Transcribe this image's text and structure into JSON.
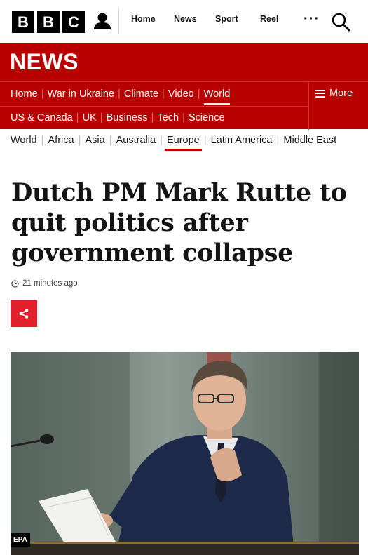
{
  "header": {
    "logo_letters": [
      "B",
      "B",
      "C"
    ],
    "nav": [
      "Home",
      "News",
      "Sport",
      "Reel"
    ],
    "more_label": "···",
    "icons": {
      "account": "account-icon",
      "search": "search-icon"
    }
  },
  "banner": {
    "title": "NEWS",
    "color": "#b80000"
  },
  "primary_nav": {
    "row1": [
      "Home",
      "War in Ukraine",
      "Climate",
      "Video",
      "World"
    ],
    "row2": [
      "US & Canada",
      "UK",
      "Business",
      "Tech",
      "Science"
    ],
    "active": "World",
    "more_label": "More"
  },
  "secondary_nav": {
    "items": [
      "World",
      "Africa",
      "Asia",
      "Australia",
      "Europe",
      "Latin America",
      "Middle East"
    ],
    "active": "Europe"
  },
  "article": {
    "headline_lines": [
      "Dutch PM Mark Rutte to",
      "quit politics after",
      "government collapse"
    ],
    "timestamp": "21 minutes ago",
    "image_credit": "EPA"
  },
  "colors": {
    "accent_red": "#b80000",
    "share_red": "#e3212d"
  }
}
